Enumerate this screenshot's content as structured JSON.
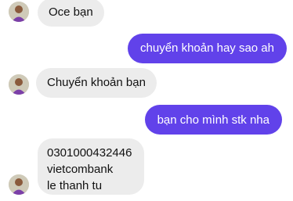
{
  "colors": {
    "incoming_bubble": "#ececec",
    "outgoing_bubble": "#6142ea",
    "incoming_text": "#111111",
    "outgoing_text": "#ffffff"
  },
  "messages": [
    {
      "side": "incoming",
      "text": "Oce bạn"
    },
    {
      "side": "outgoing",
      "text": "chuyển khoản hay sao ah"
    },
    {
      "side": "incoming",
      "text": "Chuyển khoản bạn"
    },
    {
      "side": "outgoing",
      "text": "bạn cho mình stk nha"
    },
    {
      "side": "incoming",
      "lines": [
        "0301000432446",
        "vietcombank",
        "le thanh tu"
      ]
    }
  ]
}
